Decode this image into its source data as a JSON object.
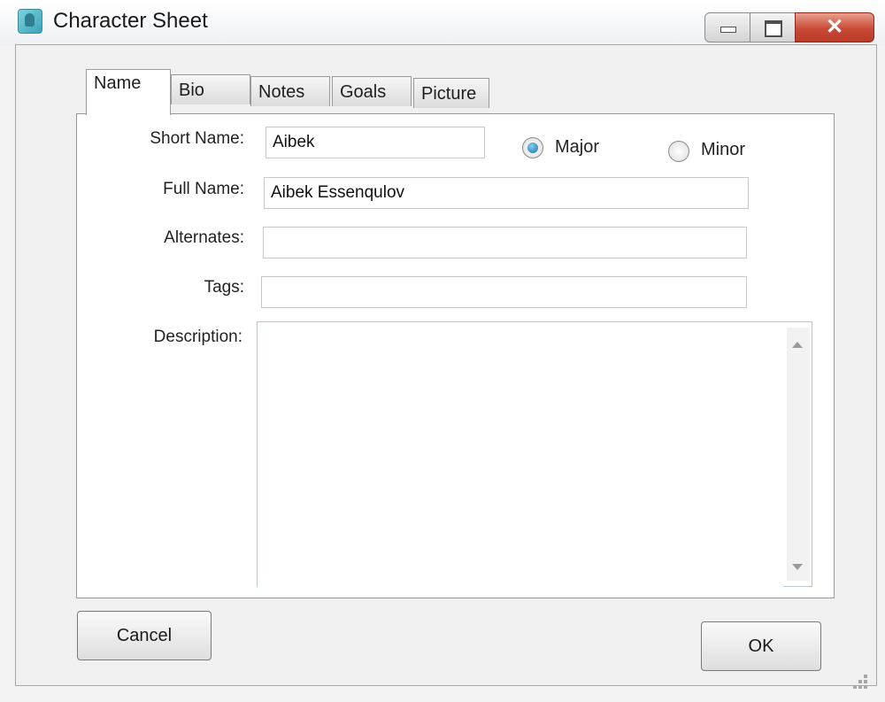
{
  "window": {
    "title": "Character Sheet",
    "controls": {
      "minimize": "minimize",
      "maximize": "maximize",
      "close": "✕"
    }
  },
  "tabs": [
    {
      "label": "Name",
      "active": true
    },
    {
      "label": "Bio",
      "active": false
    },
    {
      "label": "Notes",
      "active": false
    },
    {
      "label": "Goals",
      "active": false
    },
    {
      "label": "Picture",
      "active": false
    }
  ],
  "form": {
    "short_name": {
      "label": "Short Name:",
      "value": "Aibek"
    },
    "full_name": {
      "label": "Full Name:",
      "value": "Aibek Essenqulov"
    },
    "alternates": {
      "label": "Alternates:",
      "value": ""
    },
    "tags": {
      "label": "Tags:",
      "value": ""
    },
    "description": {
      "label": "Description:",
      "value": ""
    },
    "importance": {
      "options": [
        {
          "label": "Major",
          "checked": true
        },
        {
          "label": "Minor",
          "checked": false
        }
      ]
    }
  },
  "buttons": {
    "cancel": "Cancel",
    "ok": "OK"
  },
  "colors": {
    "close_button": "#c94a36",
    "radio_selected": "#1e6fa0",
    "description_border": "#b9c6d6"
  }
}
